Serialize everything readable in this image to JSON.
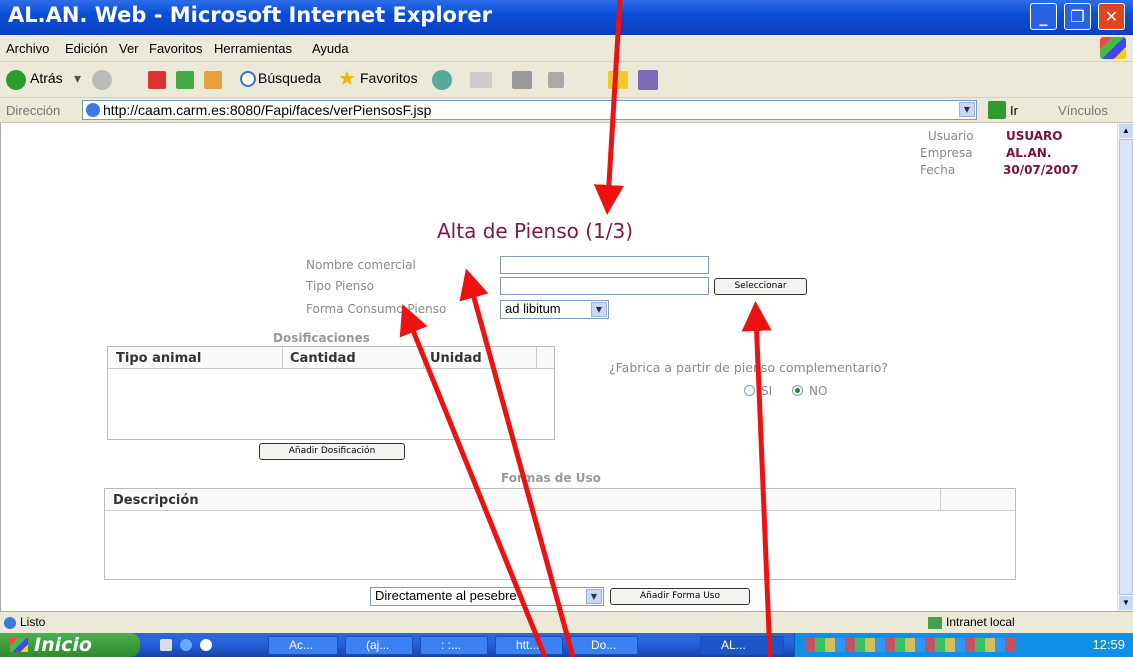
{
  "window": {
    "title": "AL.AN. Web - Microsoft Internet Explorer"
  },
  "menu": [
    "Archivo",
    "Edición",
    "Ver",
    "Favoritos",
    "Herramientas",
    "Ayuda"
  ],
  "toolbar": {
    "back": "Atrás",
    "search": "Búsqueda",
    "favorites": "Favoritos"
  },
  "address": {
    "label": "Dirección",
    "url": "http://caam.carm.es:8080/Fapi/faces/verPiensosF.jsp",
    "go": "Ir",
    "links": "Vínculos"
  },
  "user_info": {
    "user_label": "Usuario",
    "user_value": "USUARO",
    "company_label": "Empresa",
    "company_value": "AL.AN.",
    "date_label": "Fecha",
    "date_value": "30/07/2007"
  },
  "form": {
    "title": "Alta de Pienso (1/3)",
    "nombre_label": "Nombre comercial",
    "nombre_value": "",
    "tipo_label": "Tipo Pienso",
    "tipo_value": "",
    "seleccionar_button": "Seleccionar",
    "forma_label": "Forma Consumo Pienso",
    "forma_value": "ad libitum"
  },
  "dosificaciones": {
    "section": "Dosificaciones",
    "columns": [
      "Tipo animal",
      "Cantidad",
      "Unidad"
    ],
    "add_button": "Añadir Dosificación"
  },
  "complementario": {
    "question": "¿Fabrica a partir de pienso complementario?",
    "options": [
      "SI",
      "NO"
    ],
    "selected": "NO"
  },
  "formas_uso": {
    "section": "Formas de Uso",
    "columns": [
      "Descripción"
    ],
    "select_value": "Directamente al pesebre",
    "add_button": "Añadir Forma Uso"
  },
  "status": {
    "text": "Listo",
    "zone": "Intranet local"
  },
  "taskbar": {
    "start": "Inicio",
    "tasks": [
      "Ac...",
      "(aj...",
      ": :...",
      "htt...",
      "Do...",
      "AL..."
    ],
    "clock": "12:59"
  },
  "annotations": {
    "color": "#ee1111"
  }
}
